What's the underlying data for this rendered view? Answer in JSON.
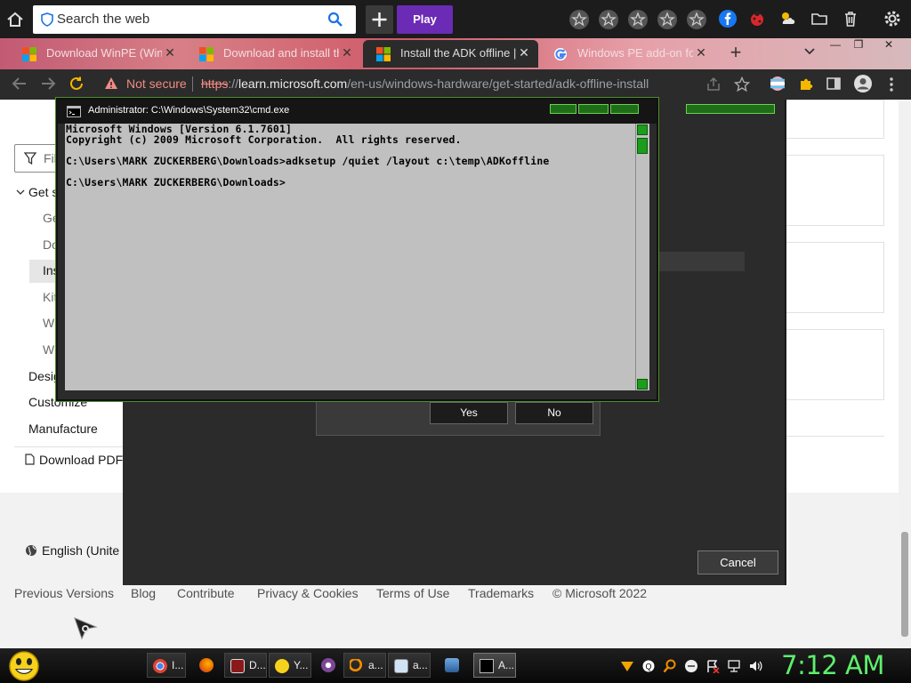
{
  "top_toolbar": {
    "search_placeholder": "Search the web",
    "play_label": "Play"
  },
  "tabs": [
    {
      "title": "Download WinPE (Windo",
      "favicon": "microsoft-favicon"
    },
    {
      "title": "Download and install the",
      "favicon": "microsoft-favicon"
    },
    {
      "title": "Install the ADK offline | M",
      "favicon": "microsoft-favicon",
      "active": true
    },
    {
      "title": "Windows PE add-on for",
      "favicon": "google-favicon"
    }
  ],
  "address_bar": {
    "security_label": "Not secure",
    "url_scheme": "https",
    "url_sep": "://",
    "url_host": "learn.microsoft.com",
    "url_path": "/en-us/windows-hardware/get-started/adk-offline-install"
  },
  "page": {
    "filter_placeholder": "Fil",
    "nav": {
      "get_started": "Get s",
      "items": [
        "Ge",
        "Do",
        "Ins",
        "Kit",
        "W",
        "W"
      ],
      "design": "Desig",
      "customize": "Customize",
      "manufacture": "Manufacture"
    },
    "download_pdf": "Download PDF",
    "language": "English (Unite",
    "footer_links": [
      "Previous Versions",
      "Blog",
      "Contribute",
      "Privacy & Cookies",
      "Terms of Use",
      "Trademarks",
      "© Microsoft 2022"
    ]
  },
  "dialog": {
    "yes_label": "Yes",
    "no_label": "No",
    "cancel_label": "Cancel"
  },
  "cmd": {
    "title": "Administrator: C:\\Windows\\System32\\cmd.exe",
    "lines": [
      "Microsoft Windows [Version 6.1.7601]",
      "Copyright (c) 2009 Microsoft Corporation.  All rights reserved.",
      "",
      "C:\\Users\\MARK ZUCKERBERG\\Downloads>adksetup /quiet /layout c:\\temp\\ADKoffline",
      "",
      "C:\\Users\\MARK ZUCKERBERG\\Downloads>"
    ]
  },
  "taskbar": {
    "buttons": [
      {
        "label": "I...",
        "icon": "chrome-icon"
      },
      {
        "label": "",
        "icon": "firefox-icon"
      },
      {
        "label": "D...",
        "icon": "document-icon"
      },
      {
        "label": "Y...",
        "icon": "smiley-icon"
      },
      {
        "label": "",
        "icon": "tor-icon"
      },
      {
        "label": "a...",
        "icon": "search-tool-icon"
      },
      {
        "label": "a...",
        "icon": "notepad-icon"
      },
      {
        "label": "",
        "icon": "network-icon"
      },
      {
        "label": "A...",
        "icon": "cmd-icon"
      }
    ],
    "clock": "7:12 AM"
  },
  "colors": {
    "accent_purple": "#6b2bb4",
    "cmd_green": "#1b9e1b",
    "clock_green": "#5ef06b",
    "not_secure_red": "#f28b82"
  }
}
